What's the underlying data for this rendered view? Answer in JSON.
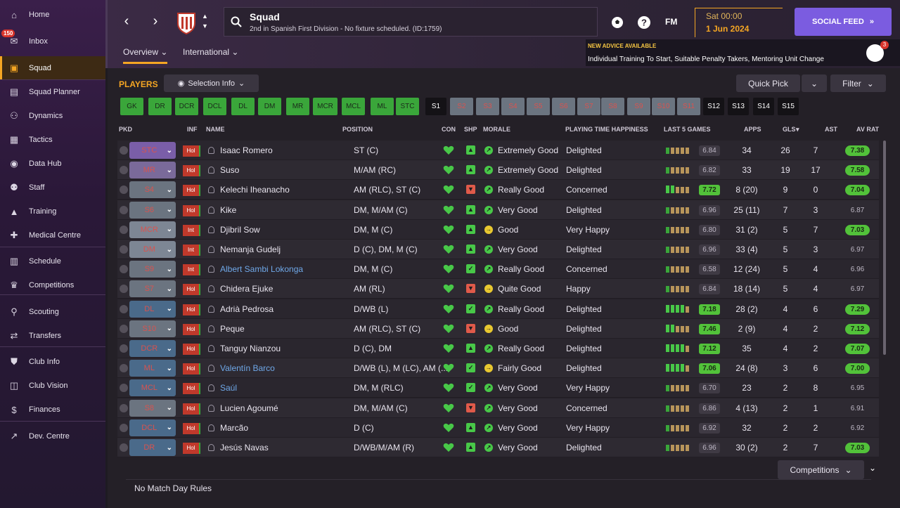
{
  "sidebar": {
    "inbox_badge": "150",
    "items": [
      {
        "label": "Home",
        "icon": "home-icon",
        "glyph": "⌂"
      },
      {
        "label": "Inbox",
        "icon": "inbox-icon",
        "glyph": "✉"
      },
      {
        "label": "Squad",
        "icon": "shirt-icon",
        "glyph": "▣"
      },
      {
        "label": "Squad Planner",
        "icon": "clipboard-icon",
        "glyph": "▤"
      },
      {
        "label": "Dynamics",
        "icon": "dynamics-icon",
        "glyph": "⚇"
      },
      {
        "label": "Tactics",
        "icon": "tactics-icon",
        "glyph": "▦"
      },
      {
        "label": "Data Hub",
        "icon": "data-hub-icon",
        "glyph": "◉"
      },
      {
        "label": "Staff",
        "icon": "staff-icon",
        "glyph": "⚉"
      },
      {
        "label": "Training",
        "icon": "training-cone-icon",
        "glyph": "▲"
      },
      {
        "label": "Medical Centre",
        "icon": "medical-kit-icon",
        "glyph": "✚"
      },
      {
        "label": "Schedule",
        "icon": "calendar-icon",
        "glyph": "▥"
      },
      {
        "label": "Competitions",
        "icon": "trophy-icon",
        "glyph": "♛"
      },
      {
        "label": "Scouting",
        "icon": "magnifier-icon",
        "glyph": "⚲"
      },
      {
        "label": "Transfers",
        "icon": "transfers-icon",
        "glyph": "⇄"
      },
      {
        "label": "Club Info",
        "icon": "shield-icon",
        "glyph": "⛊"
      },
      {
        "label": "Club Vision",
        "icon": "briefcase-icon",
        "glyph": "◫"
      },
      {
        "label": "Finances",
        "icon": "finances-icon",
        "glyph": "$"
      },
      {
        "label": "Dev. Centre",
        "icon": "dev-centre-icon",
        "glyph": "↗"
      }
    ]
  },
  "header": {
    "title": "Squad",
    "subtitle": "2nd in Spanish First Division - No fixture scheduled. (ID:1759)",
    "fm_label": "FM",
    "date_line1": "Sat 00:00",
    "date_line2": "1 Jun 2024",
    "social_label": "SOCIAL FEED",
    "tabs": [
      "Overview",
      "International"
    ],
    "advice_title": "NEW ADVICE AVAILABLE",
    "advice_text": "Individual Training To Start, Suitable Penalty Takers, Mentoring Unit Change",
    "advice_count": "3"
  },
  "toolbar": {
    "players_label": "PLAYERS",
    "selection_info": "Selection Info",
    "quick_pick": "Quick Pick",
    "filter": "Filter"
  },
  "position_chips": [
    "GK",
    "DR",
    "DCR",
    "DCL",
    "DL",
    "DM",
    "MR",
    "MCR",
    "MCL",
    "ML",
    "STC",
    "S1",
    "S2",
    "S3",
    "S4",
    "S5",
    "S6",
    "S7",
    "S8",
    "S9",
    "S10",
    "S11",
    "S12",
    "S13",
    "S14",
    "S15"
  ],
  "columns": [
    "PKD",
    "INF",
    "NAME",
    "POSITION",
    "CON",
    "SHP",
    "MORALE",
    "PLAYING TIME HAPPINESS",
    "LAST 5 GAMES",
    "APPS",
    "GLS",
    "AST",
    "AV RAT"
  ],
  "players": [
    {
      "pos": "STC",
      "inf": "Hol",
      "name": "Isaac Romero",
      "position": "ST (C)",
      "shp": "up",
      "morale": "Extremely Good",
      "happy": "Delighted",
      "last5": "6.84",
      "apps": "34",
      "gls": "26",
      "ast": "7",
      "avrat": "7.38"
    },
    {
      "pos": "MR",
      "inf": "Hol",
      "name": "Suso",
      "position": "M/AM (RC)",
      "shp": "up",
      "morale": "Extremely Good",
      "happy": "Delighted",
      "last5": "6.82",
      "apps": "33",
      "gls": "19",
      "ast": "17",
      "avrat": "7.58"
    },
    {
      "pos": "S4",
      "inf": "Hol",
      "name": "Kelechi Iheanacho",
      "position": "AM (RLC), ST (C)",
      "shp": "down",
      "morale": "Really Good",
      "happy": "Concerned",
      "last5": "7.72",
      "apps": "8 (20)",
      "gls": "9",
      "ast": "0",
      "avrat": "7.04"
    },
    {
      "pos": "S6",
      "inf": "Hol",
      "name": "Kike",
      "position": "DM, M/AM (C)",
      "shp": "up",
      "morale": "Very Good",
      "happy": "Delighted",
      "last5": "6.96",
      "apps": "25 (11)",
      "gls": "7",
      "ast": "3",
      "avrat": "6.87"
    },
    {
      "pos": "MCR",
      "inf": "Int",
      "name": "Djibril Sow",
      "position": "DM, M (C)",
      "shp": "up",
      "morale": "Good",
      "happy": "Very Happy",
      "last5": "6.80",
      "apps": "31 (2)",
      "gls": "5",
      "ast": "7",
      "avrat": "7.03"
    },
    {
      "pos": "DM",
      "inf": "Int",
      "name": "Nemanja Gudelj",
      "position": "D (C), DM, M (C)",
      "shp": "up",
      "morale": "Very Good",
      "happy": "Delighted",
      "last5": "6.96",
      "apps": "33 (4)",
      "gls": "5",
      "ast": "3",
      "avrat": "6.97"
    },
    {
      "pos": "S9",
      "inf": "Int",
      "name": "Albert Sambi Lokonga",
      "position": "DM, M (C)",
      "shp": "check",
      "morale": "Really Good",
      "happy": "Concerned",
      "last5": "6.58",
      "apps": "12 (24)",
      "gls": "5",
      "ast": "4",
      "avrat": "6.96"
    },
    {
      "pos": "S7",
      "inf": "Hol",
      "name": "Chidera Ejuke",
      "position": "AM (RL)",
      "shp": "down",
      "morale": "Quite Good",
      "happy": "Happy",
      "last5": "6.84",
      "apps": "18 (14)",
      "gls": "5",
      "ast": "4",
      "avrat": "6.97"
    },
    {
      "pos": "DL",
      "inf": "Hol",
      "name": "Adrià Pedrosa",
      "position": "D/WB (L)",
      "shp": "check",
      "morale": "Really Good",
      "happy": "Delighted",
      "last5": "7.18",
      "apps": "28 (2)",
      "gls": "4",
      "ast": "6",
      "avrat": "7.29"
    },
    {
      "pos": "S10",
      "inf": "Hol",
      "name": "Peque",
      "position": "AM (RLC), ST (C)",
      "shp": "down",
      "morale": "Good",
      "happy": "Delighted",
      "last5": "7.46",
      "apps": "2 (9)",
      "gls": "4",
      "ast": "2",
      "avrat": "7.12"
    },
    {
      "pos": "DCR",
      "inf": "Hol",
      "name": "Tanguy Nianzou",
      "position": "D (C), DM",
      "shp": "up",
      "morale": "Really Good",
      "happy": "Delighted",
      "last5": "7.12",
      "apps": "35",
      "gls": "4",
      "ast": "2",
      "avrat": "7.07"
    },
    {
      "pos": "ML",
      "inf": "Hol",
      "name": "Valentín Barco",
      "position": "D/WB (L), M (LC), AM (...",
      "shp": "check",
      "morale": "Fairly Good",
      "happy": "Delighted",
      "last5": "7.06",
      "apps": "24 (8)",
      "gls": "3",
      "ast": "6",
      "avrat": "7.00"
    },
    {
      "pos": "MCL",
      "inf": "Hol",
      "name": "Saúl",
      "position": "DM, M (RLC)",
      "shp": "check",
      "morale": "Very Good",
      "happy": "Very Happy",
      "last5": "6.70",
      "apps": "23",
      "gls": "2",
      "ast": "8",
      "avrat": "6.95"
    },
    {
      "pos": "S8",
      "inf": "Hol",
      "name": "Lucien Agoumé",
      "position": "DM, M/AM (C)",
      "shp": "down",
      "morale": "Very Good",
      "happy": "Concerned",
      "last5": "6.86",
      "apps": "4 (13)",
      "gls": "2",
      "ast": "1",
      "avrat": "6.91"
    },
    {
      "pos": "DCL",
      "inf": "Hol",
      "name": "Marcão",
      "position": "D (C)",
      "shp": "up",
      "morale": "Very Good",
      "happy": "Very Happy",
      "last5": "6.92",
      "apps": "32",
      "gls": "2",
      "ast": "2",
      "avrat": "6.92"
    },
    {
      "pos": "DR",
      "inf": "Hol",
      "name": "Jesús Navas",
      "position": "D/WB/M/AM (R)",
      "shp": "up",
      "morale": "Very Good",
      "happy": "Delighted",
      "last5": "6.96",
      "apps": "30 (2)",
      "gls": "2",
      "ast": "7",
      "avrat": "7.03"
    }
  ],
  "competitions_label": "Competitions",
  "footer_text": "No Match Day Rules"
}
